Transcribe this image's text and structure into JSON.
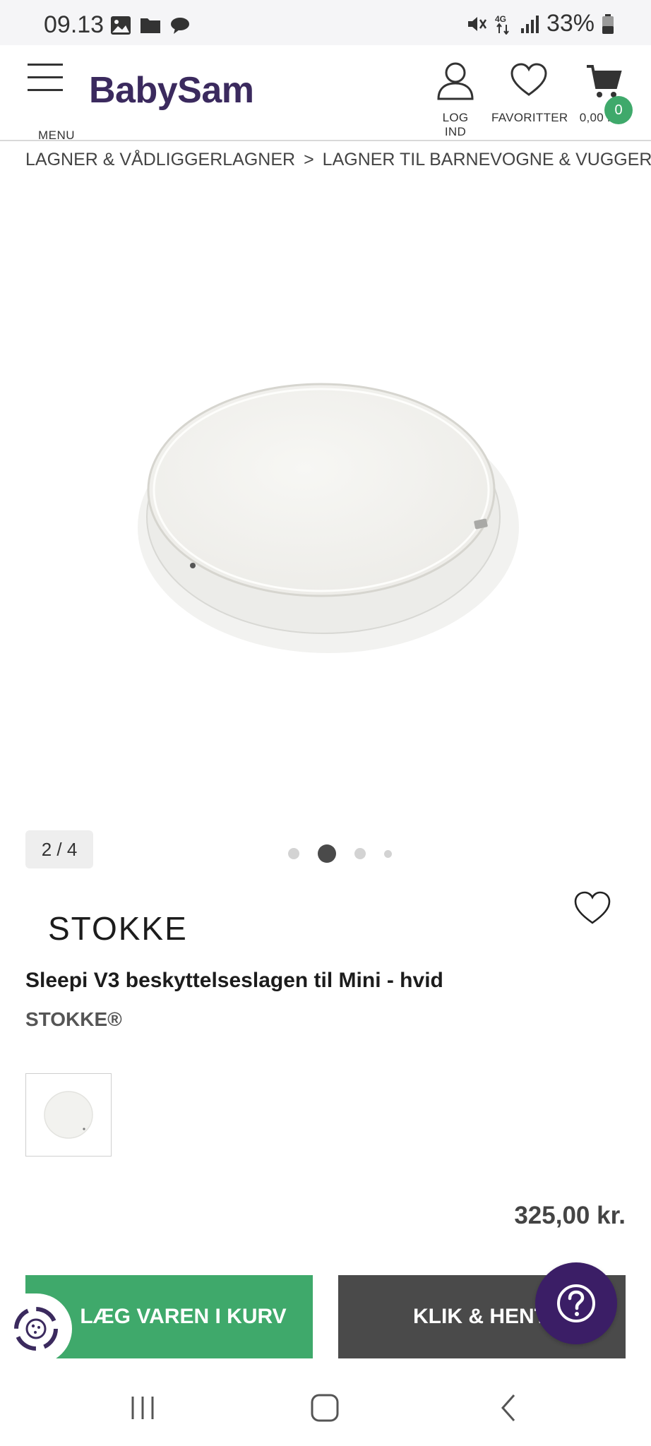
{
  "status_bar": {
    "time": "09.13",
    "battery": "33%"
  },
  "header": {
    "menu_label": "MENU",
    "logo": "BabySam",
    "login_label": "LOG IND",
    "favorites_label": "FAVORITTER",
    "cart_total": "0,00 KR.",
    "cart_count": "0"
  },
  "breadcrumb": {
    "items": [
      "LAGNER & VÅDLIGGERLAGNER",
      "LAGNER TIL BARNEVOGNE & VUGGER"
    ],
    "separator": ">"
  },
  "gallery": {
    "counter": "2 / 4",
    "total_slides": 4,
    "active_slide": 2
  },
  "product": {
    "brand_logo_text": "STOKKE",
    "title": "Sleepi V3 beskyttelseslagen til Mini - hvid",
    "brand": "STOKKE®",
    "price": "325,00 kr."
  },
  "actions": {
    "add_to_cart": "LÆG VAREN I KURV",
    "click_collect": "KLIK & HENT"
  },
  "colors": {
    "brand_purple": "#3b2a5e",
    "green": "#3fa96b",
    "dark_button": "#4a4a4a",
    "help_purple": "#3b1e66"
  }
}
